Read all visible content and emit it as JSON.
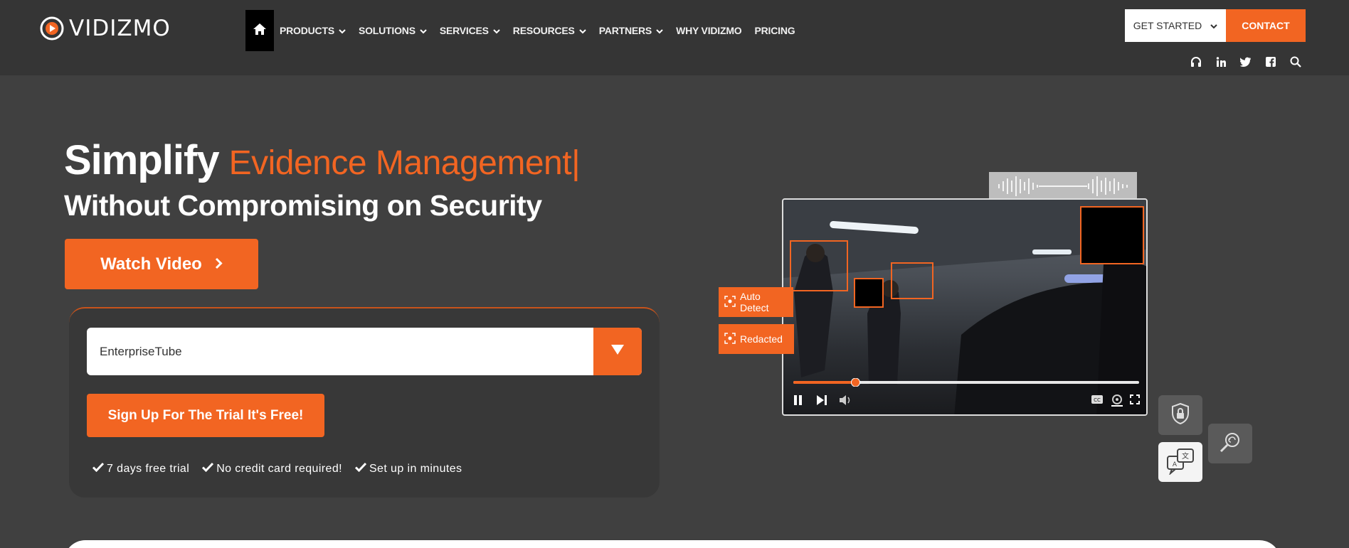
{
  "brand": {
    "name": "VIDIZMO"
  },
  "nav": {
    "items": [
      {
        "label": "PRODUCTS",
        "dropdown": true
      },
      {
        "label": "SOLUTIONS",
        "dropdown": true
      },
      {
        "label": "SERVICES",
        "dropdown": true
      },
      {
        "label": "RESOURCES",
        "dropdown": true
      },
      {
        "label": "PARTNERS",
        "dropdown": true
      },
      {
        "label": "WHY VIDIZMO",
        "dropdown": false
      },
      {
        "label": "PRICING",
        "dropdown": false
      }
    ],
    "get_started": "GET STARTED",
    "contact": "CONTACT"
  },
  "social_icons": [
    "headset-icon",
    "linkedin-icon",
    "twitter-icon",
    "facebook-icon",
    "search-icon"
  ],
  "hero": {
    "title_lead": "Simplify",
    "title_accent": "Evidence Management|",
    "subtitle": "Without Compromising on Security",
    "watch_video": "Watch Video"
  },
  "signup": {
    "product_select_value": "EnterpriseTube",
    "cta": "Sign Up For The Trial It's Free!",
    "features": [
      "7 days free trial",
      "No credit card required!",
      "Set up in minutes"
    ]
  },
  "video_demo": {
    "tags": [
      "Auto Detect",
      "Redacted"
    ],
    "progress": 0.18
  },
  "colors": {
    "accent": "#f26522",
    "header_bg": "#353535",
    "page_bg": "#404040"
  }
}
